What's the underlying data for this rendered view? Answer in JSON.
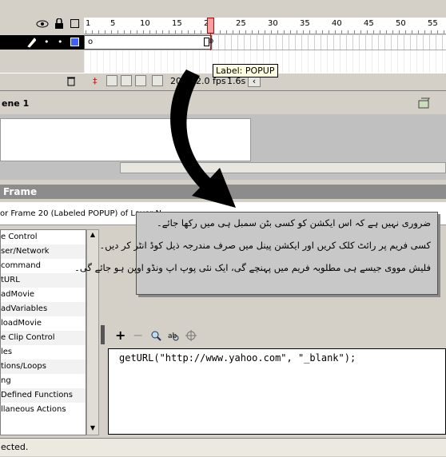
{
  "timeline": {
    "ruler_numbers": [
      "1",
      "5",
      "10",
      "15",
      "20",
      "25",
      "30",
      "35",
      "40",
      "45",
      "50",
      "55"
    ],
    "current_frame": "20",
    "fps": "12.0 fps",
    "elapsed": "1.6s",
    "tooltip": "Label: POPUP"
  },
  "scene": {
    "label": "ene 1"
  },
  "actions": {
    "title": "Frame",
    "description": "or Frame 20 (Labeled POPUP)  of Layer N",
    "tree_items": [
      "e Control",
      "ser/Network",
      "command",
      "tURL",
      "adMovie",
      "adVariables",
      "loadMovie",
      "e Clip Control",
      "les",
      "tions/Loops",
      "ng",
      "Defined Functions",
      "llaneous Actions"
    ],
    "code": "getURL(\"http://www.yahoo.com\", \"_blank\");"
  },
  "callout": {
    "line1": "ضروری نہیں ہے کہ اس ایکشن کو کسی بٹن سمبل ہی میں رکھا جائے۔",
    "line2": "کسی فریم پر رائٹ کلک کریں اور ایکشن پینل میں صرف مندرجہ ذیل کوڈ انٹر کر دیں۔",
    "line3": "فلیش مووی جیسے ہی مطلوبہ فریم میں پہنچے گی، ایک نئی پوپ اپ ونڈو اوپن ہو جائے گی۔"
  },
  "status": {
    "text": "ected."
  },
  "colors": {
    "playhead": "#e00000",
    "layer_row": "#000000",
    "panel_title": "#8c8c8c"
  }
}
